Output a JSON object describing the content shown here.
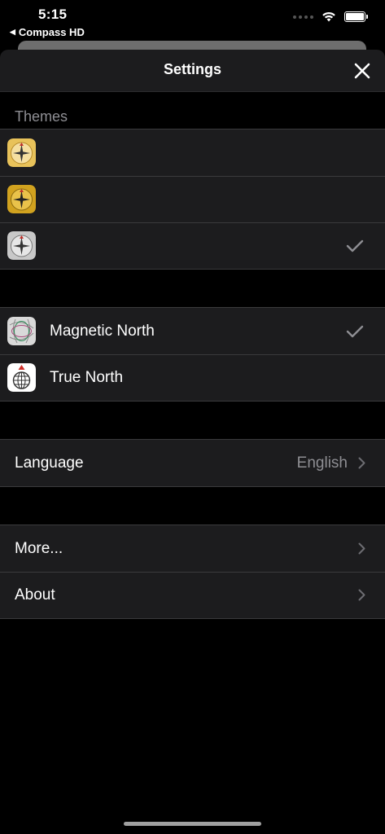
{
  "status": {
    "time": "5:15",
    "back_app": "Compass HD"
  },
  "nav": {
    "title": "Settings"
  },
  "themes": {
    "header": "Themes",
    "items": [
      {
        "selected": false,
        "icon": "compass-gold-light-icon"
      },
      {
        "selected": false,
        "icon": "compass-gold-dark-icon"
      },
      {
        "selected": true,
        "icon": "compass-silver-icon"
      }
    ]
  },
  "north": {
    "items": [
      {
        "label": "Magnetic North",
        "selected": true,
        "icon": "magnetic-north-icon"
      },
      {
        "label": "True North",
        "selected": false,
        "icon": "true-north-icon"
      }
    ]
  },
  "language": {
    "label": "Language",
    "value": "English"
  },
  "more": {
    "more_label": "More...",
    "about_label": "About"
  },
  "colors": {
    "background": "#000000",
    "cell": "#1c1c1e",
    "secondary_text": "#8e8e93",
    "separator": "#3a3a3c"
  }
}
